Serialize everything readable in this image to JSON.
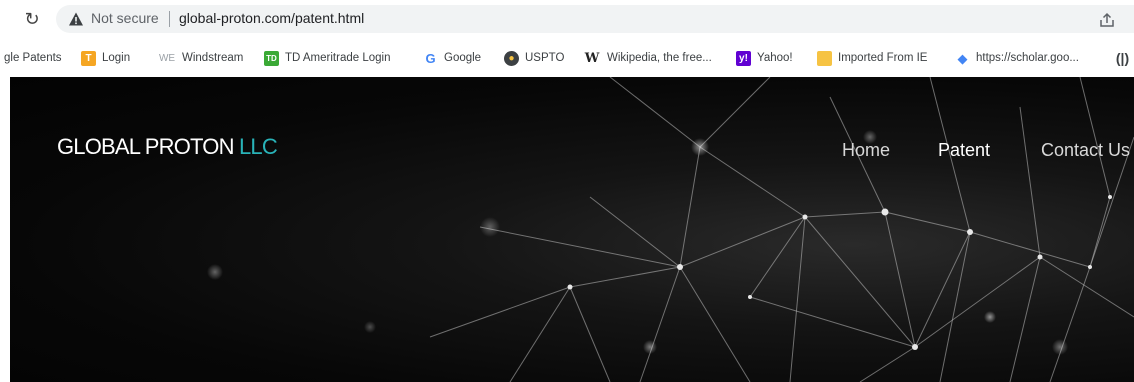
{
  "browser": {
    "security_label": "Not secure",
    "url": "global-proton.com/patent.html"
  },
  "bookmarks": [
    {
      "label": "gle Patents",
      "icon": "google-patents-icon"
    },
    {
      "label": "Login",
      "icon": "login-icon",
      "color": "#f5a623"
    },
    {
      "label": "Windstream",
      "icon": "windstream-icon"
    },
    {
      "label": "TD Ameritrade Login",
      "icon": "td-ameritrade-icon",
      "color": "#3aa935"
    },
    {
      "label": "Google",
      "icon": "google-icon"
    },
    {
      "label": "USPTO",
      "icon": "uspto-icon"
    },
    {
      "label": "Wikipedia, the free...",
      "icon": "wikipedia-icon"
    },
    {
      "label": "Yahoo!",
      "icon": "yahoo-icon",
      "color": "#6001d2"
    },
    {
      "label": "Imported From IE",
      "icon": "folder-icon",
      "color": "#f6c343"
    },
    {
      "label": "https://scholar.goo...",
      "icon": "scholar-icon",
      "color": "#4285f4"
    }
  ],
  "site": {
    "logo_main": "GLOBAL PROTON",
    "logo_accent": "LLC",
    "accent_color": "#29b3b8",
    "nav": [
      {
        "label": "Home"
      },
      {
        "label": "Patent"
      },
      {
        "label": "Contact Us"
      }
    ]
  }
}
